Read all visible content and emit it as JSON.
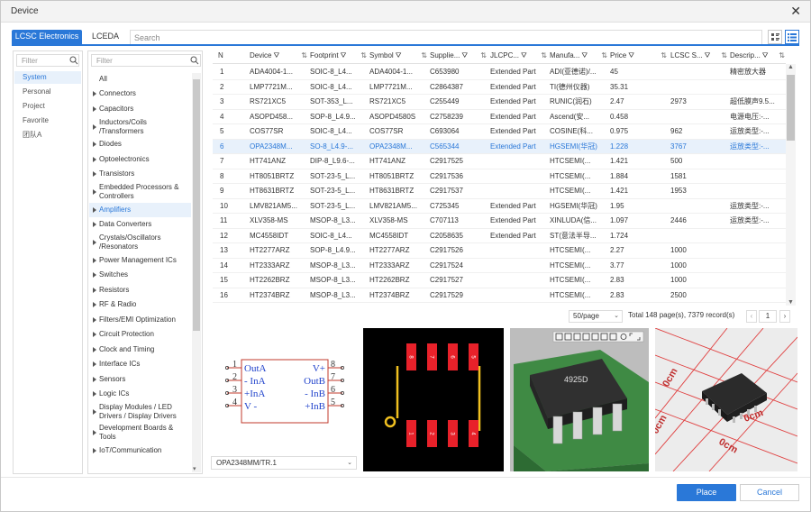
{
  "window": {
    "title": "Device"
  },
  "tabs": [
    {
      "label": "LCSC Electronics"
    },
    {
      "label": "LCEDA"
    }
  ],
  "search": {
    "placeholder": "Search"
  },
  "sources": {
    "filter_placeholder": "Filter",
    "items": [
      "System",
      "Personal",
      "Project",
      "Favorite",
      "团队A"
    ],
    "selected": 0
  },
  "categories": {
    "filter_placeholder": "Filter",
    "all_label": "All",
    "items": [
      "Connectors",
      "Capacitors",
      "Inductors/Coils\n/Transformers",
      "Diodes",
      "Optoelectronics",
      "Transistors",
      "Embedded Processors &\nControllers",
      "Amplifiers",
      "Data Converters",
      "Crystals/Oscillators\n/Resonators",
      "Power Management ICs",
      "Switches",
      "Resistors",
      "RF & Radio",
      "Filters/EMI Optimization",
      "Circuit Protection",
      "Clock and Timing",
      "Interface ICs",
      "Sensors",
      "Logic ICs",
      "Display Modules / LED\nDrivers / Display Drivers",
      "Development Boards &\nTools",
      "IoT/Communication"
    ],
    "selected": 7
  },
  "table": {
    "columns": [
      "N",
      "Device",
      "Footprint",
      "Symbol",
      "Supplie...",
      "JLCPC...",
      "Manufa...",
      "Price",
      "LCSC S...",
      "Descrip..."
    ],
    "rows": [
      [
        "1",
        "ADA4004-1...",
        "SOIC-8_L4...",
        "ADA4004-1...",
        "C653980",
        "Extended Part",
        "ADI(亚德诺)/...",
        "45",
        "",
        "精密放大器"
      ],
      [
        "2",
        "LMP7721M...",
        "SOIC-8_L4...",
        "LMP7721M...",
        "C2864387",
        "Extended Part",
        "TI(德州仪器)",
        "35.31",
        "",
        ""
      ],
      [
        "3",
        "RS721XC5",
        "SOT-353_L...",
        "RS721XC5",
        "C255449",
        "Extended Part",
        "RUNIC(润石)",
        "2.47",
        "2973",
        "超低膜声9.5..."
      ],
      [
        "4",
        "ASOPD458...",
        "SOP-8_L4.9...",
        "ASOPD4580S",
        "C2758239",
        "Extended Part",
        "Ascend(安...",
        "0.458",
        "",
        "电源电压:-..."
      ],
      [
        "5",
        "COS77SR",
        "SOIC-8_L4...",
        "COS77SR",
        "C693064",
        "Extended Part",
        "COSINE(科...",
        "0.975",
        "962",
        "运放类型:-..."
      ],
      [
        "6",
        "OPA2348M...",
        "SO-8_L4.9-...",
        "OPA2348M...",
        "C565344",
        "Extended Part",
        "HGSEMI(华冠)",
        "1.228",
        "3767",
        "运放类型:-..."
      ],
      [
        "7",
        "HT741ANZ",
        "DIP-8_L9.6-...",
        "HT741ANZ",
        "C2917525",
        "",
        "HTCSEMI(...",
        "1.421",
        "500",
        ""
      ],
      [
        "8",
        "HT8051BRTZ",
        "SOT-23-5_L...",
        "HT8051BRTZ",
        "C2917536",
        "",
        "HTCSEMI(...",
        "1.884",
        "1581",
        ""
      ],
      [
        "9",
        "HT8631BRTZ",
        "SOT-23-5_L...",
        "HT8631BRTZ",
        "C2917537",
        "",
        "HTCSEMI(...",
        "1.421",
        "1953",
        ""
      ],
      [
        "10",
        "LMV821AM5...",
        "SOT-23-5_L...",
        "LMV821AM5...",
        "C725345",
        "Extended Part",
        "HGSEMI(华冠)",
        "1.95",
        "",
        "运放类型:-..."
      ],
      [
        "11",
        "XLV358-MS",
        "MSOP-8_L3...",
        "XLV358-MS",
        "C707113",
        "Extended Part",
        "XINLUDA(信...",
        "1.097",
        "2446",
        "运放类型:-..."
      ],
      [
        "12",
        "MC4558IDT",
        "SOIC-8_L4...",
        "MC4558IDT",
        "C2058635",
        "Extended Part",
        "ST(意法半导...",
        "1.724",
        "",
        ""
      ],
      [
        "13",
        "HT2277ARZ",
        "SOP-8_L4.9...",
        "HT2277ARZ",
        "C2917526",
        "",
        "HTCSEMI(...",
        "2.27",
        "1000",
        ""
      ],
      [
        "14",
        "HT2333ARZ",
        "MSOP-8_L3...",
        "HT2333ARZ",
        "C2917524",
        "",
        "HTCSEMI(...",
        "3.77",
        "1000",
        ""
      ],
      [
        "15",
        "HT2262BRZ",
        "MSOP-8_L3...",
        "HT2262BRZ",
        "C2917527",
        "",
        "HTCSEMI(...",
        "2.83",
        "1000",
        ""
      ],
      [
        "16",
        "HT2374BRZ",
        "MSOP-8_L3...",
        "HT2374BRZ",
        "C2917529",
        "",
        "HTCSEMI(...",
        "2.83",
        "2500",
        ""
      ]
    ],
    "selected_row": 5
  },
  "pagination": {
    "per_page": "50/page",
    "total": "Total 148 page(s), 7379 record(s)",
    "current_page": "1"
  },
  "symbol_preview": {
    "pins_left": [
      "1",
      "2",
      "3",
      "4"
    ],
    "pins_right": [
      "8",
      "7",
      "6",
      "5"
    ],
    "labels_left": [
      "OutA",
      "- InA",
      "+InA",
      "V -"
    ],
    "labels_right": [
      "V+",
      "OutB",
      "- InB",
      "+InB"
    ]
  },
  "footprint_preview": {
    "pads_top": [
      "8",
      "7",
      "6",
      "5"
    ],
    "pads_bottom": [
      "1",
      "2",
      "3",
      "4"
    ]
  },
  "model_preview": {
    "chip_marking": "4925D"
  },
  "photo_preview": {
    "scale_labels": [
      "0cm",
      "0cm",
      "0cm",
      "0cm"
    ]
  },
  "part_select": {
    "value": "OPA2348MM/TR.1"
  },
  "buttons": {
    "place": "Place",
    "cancel": "Cancel"
  }
}
